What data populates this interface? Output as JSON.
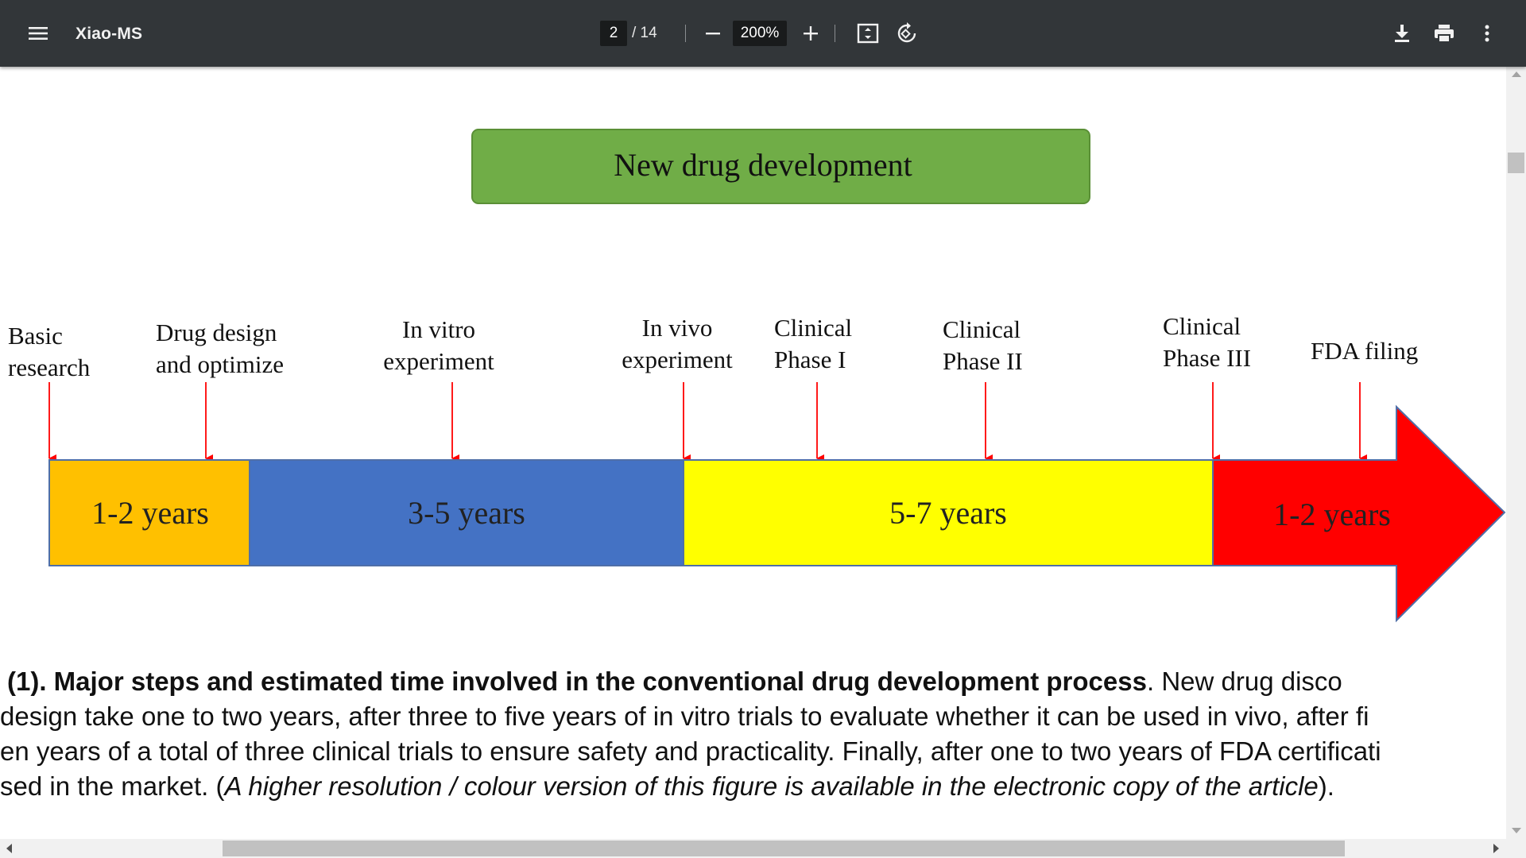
{
  "toolbar": {
    "title": "Xiao-MS",
    "current_page": "2",
    "page_total": "/ 14",
    "zoom": "200%",
    "icons": [
      "menu-icon",
      "minus-icon",
      "plus-icon",
      "fit-page-icon",
      "rotate-icon",
      "download-icon",
      "print-icon",
      "more-vert-icon"
    ]
  },
  "figure": {
    "title": "New drug development",
    "steps": [
      {
        "line1": "Basic",
        "line2": "research"
      },
      {
        "line1": "Drug design",
        "line2": "and optimize"
      },
      {
        "line1": "In vitro",
        "line2": "experiment"
      },
      {
        "line1": "In vivo",
        "line2": "experiment"
      },
      {
        "line1": "Clinical",
        "line2": "Phase I"
      },
      {
        "line1": "Clinical",
        "line2": "Phase II"
      },
      {
        "line1": "Clinical",
        "line2": "Phase III"
      },
      {
        "line1": "FDA filing",
        "line2": ""
      }
    ],
    "segments": [
      {
        "label": "1-2 years",
        "color": "#FFC000"
      },
      {
        "label": "3-5 years",
        "color": "#4472C4"
      },
      {
        "label": "5-7 years",
        "color": "#FFFF00"
      },
      {
        "label": "1-2 years",
        "color": "#FF0000"
      }
    ],
    "title_box_color": "#70AD47",
    "marker_color": "#FF0000"
  },
  "caption": {
    "l1_bold": "(1). Major steps and estimated time involved in the conventional drug development process",
    "l1_rest": ". New drug disco",
    "l2": "design take one to two years, after three to five years of in vitro trials to evaluate whether it can be used in vivo, after fi",
    "l3": "en years of a total of three clinical trials to ensure safety and practicality. Finally, after one to two years of FDA certificati",
    "l4_pre": "sed in the market. (",
    "l4_italic": "A higher resolution / colour version of this figure is available in the electronic copy of the article",
    "l4_post": ")."
  }
}
